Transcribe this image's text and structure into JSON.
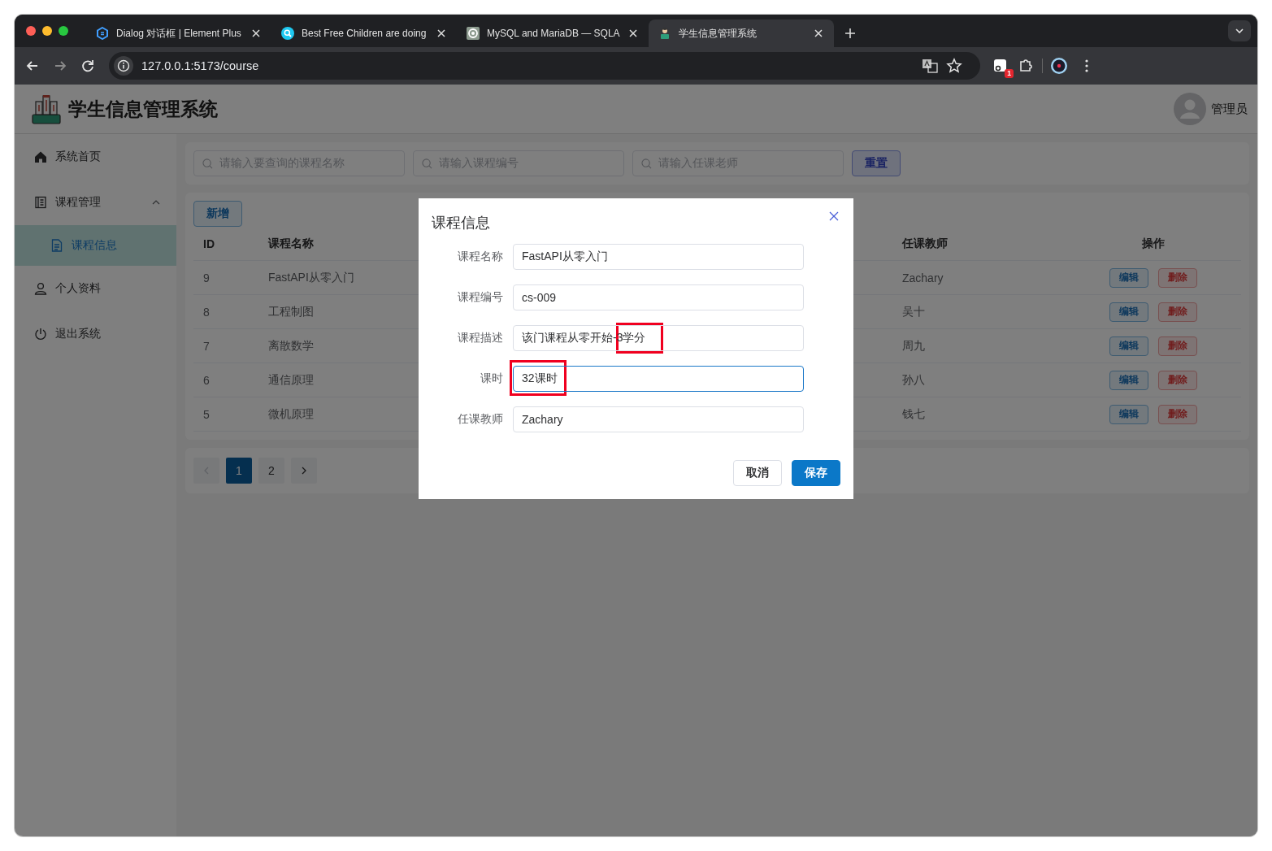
{
  "browser": {
    "tabs": [
      {
        "title": "Dialog 对话框 | Element Plus",
        "kind": "element",
        "selected": false
      },
      {
        "title": "Best Free Children are doing",
        "kind": "search",
        "selected": false
      },
      {
        "title": "MySQL and MariaDB — SQLA",
        "kind": "ring",
        "selected": false
      },
      {
        "title": "学生信息管理系统",
        "kind": "student",
        "selected": true
      }
    ],
    "url": "127.0.0.1:5173/course",
    "extension_badge": "1"
  },
  "header": {
    "title": "学生信息管理系统",
    "user": "管理员"
  },
  "sidebar": {
    "items": [
      {
        "label": "系统首页",
        "kind": "home",
        "selected": false
      },
      {
        "label": "课程管理",
        "kind": "book",
        "selected": false,
        "expanded": true,
        "children": [
          {
            "label": "课程信息",
            "kind": "doc",
            "selected": true
          }
        ]
      },
      {
        "label": "个人资料",
        "kind": "user",
        "selected": false
      },
      {
        "label": "退出系统",
        "kind": "power",
        "selected": false
      }
    ]
  },
  "search": {
    "fields": [
      {
        "placeholder": "请输入要查询的课程名称"
      },
      {
        "placeholder": "请输入课程编号"
      },
      {
        "placeholder": "请输入任课老师"
      }
    ],
    "reset_button": "重置"
  },
  "table": {
    "add_button": "新增",
    "columns": [
      "ID",
      "课程名称",
      "任课教师",
      "操作"
    ],
    "rows": [
      {
        "id": "9",
        "name": "FastAPI从零入门",
        "teacher": "Zachary",
        "edit": "编辑",
        "delete": "删除"
      },
      {
        "id": "8",
        "name": "工程制图",
        "teacher": "吴十",
        "edit": "编辑",
        "delete": "删除"
      },
      {
        "id": "7",
        "name": "离散数学",
        "teacher": "周九",
        "edit": "编辑",
        "delete": "删除"
      },
      {
        "id": "6",
        "name": "通信原理",
        "teacher": "孙八",
        "edit": "编辑",
        "delete": "删除"
      },
      {
        "id": "5",
        "name": "微机原理",
        "teacher": "钱七",
        "edit": "编辑",
        "delete": "删除"
      }
    ]
  },
  "pagination": {
    "pages": [
      {
        "label": "1",
        "selected": true
      },
      {
        "label": "2",
        "selected": false
      }
    ],
    "prev_disabled": true
  },
  "dialog": {
    "title": "课程信息",
    "fields": [
      {
        "label": "课程名称",
        "value": "FastAPI从零入门",
        "focused": false,
        "kind": "plain"
      },
      {
        "label": "课程编号",
        "value": "cs-009",
        "focused": false,
        "kind": "plain"
      },
      {
        "label": "课程描述",
        "value": "该门课程从零开始-3学分",
        "focused": false,
        "kind": "tail_framed"
      },
      {
        "label": "课时",
        "value": "32课时",
        "focused": true,
        "kind": "head_framed"
      },
      {
        "label": "任课教师",
        "value": "Zachary",
        "focused": false,
        "kind": "plain"
      }
    ],
    "cancel_button": "取消",
    "save_button": "保存"
  }
}
